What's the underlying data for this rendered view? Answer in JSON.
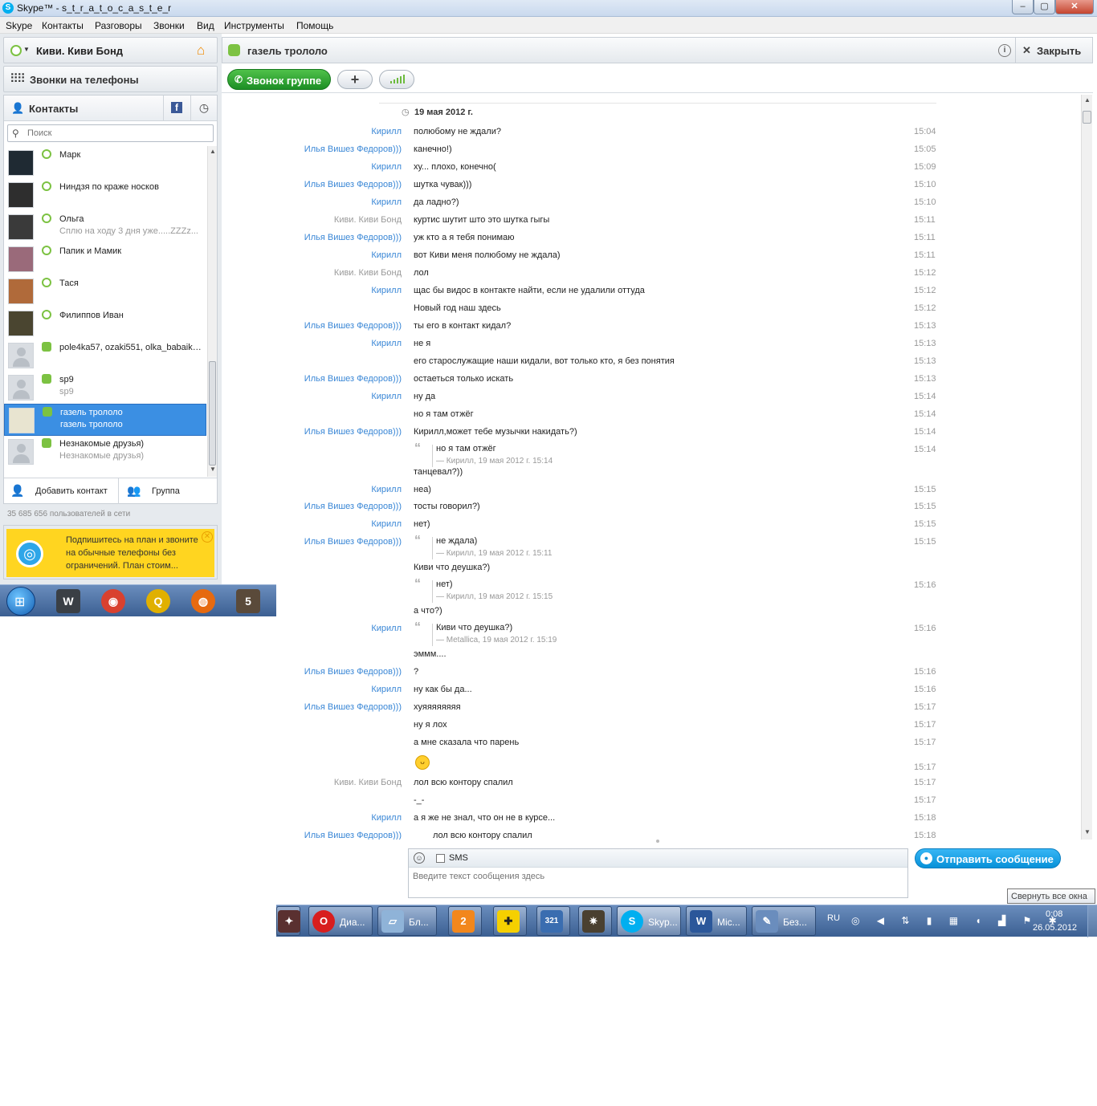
{
  "window": {
    "title": "Skype™ - s_t_r_a_t_o_c_a_s_t_e_r",
    "min_label": "–",
    "max_label": "▢",
    "close_label": "✕"
  },
  "menu": [
    "Skype",
    "Контакты",
    "Разговоры",
    "Звонки",
    "Вид",
    "Инструменты",
    "Помощь"
  ],
  "profile": {
    "name": "Киви. Киви Бонд",
    "home_icon": "⌂"
  },
  "phones": {
    "label": "Звонки на телефоны"
  },
  "contacts": {
    "tab_label": "Контакты",
    "fb_label": "f",
    "recent_icon": "◷",
    "search_placeholder": "Поиск",
    "items": [
      {
        "name": "Марк",
        "sub": ""
      },
      {
        "name": "Ниндзя по краже носков",
        "sub": ""
      },
      {
        "name": "Ольга",
        "sub": "Сплю на ходу 3 дня уже.....ZZZz..."
      },
      {
        "name": "Папик и Мамик",
        "sub": ""
      },
      {
        "name": "Тася",
        "sub": ""
      },
      {
        "name": "Филиппов Иван",
        "sub": ""
      },
      {
        "name": "pole4ka57, ozaki551, olka_babaika...",
        "sub": ""
      },
      {
        "name": "sp9",
        "sub": "sp9"
      },
      {
        "name": "газель трололо",
        "sub": "газель трололо"
      },
      {
        "name": "Незнакомые друзья)",
        "sub": "Незнакомые друзья)"
      }
    ],
    "add_contact": "Добавить контакт",
    "group": "Группа",
    "online": "35 685 656 пользователей в сети"
  },
  "promo": {
    "text": "Подпишитесь на план и звоните на обычные телефоны без ограничений. План стоим..."
  },
  "chat": {
    "title": "газель трололо",
    "info_label": "i",
    "close_label": "Закрыть",
    "call_group": "Звонок группе",
    "add_label": "+",
    "date": "19 мая 2012 г.",
    "messages": [
      {
        "who": "Кирилл",
        "text": "полюбому не ждали?",
        "time": "15:04"
      },
      {
        "who": "Илья Вишез Федоров)))",
        "text": "канечно!)",
        "time": "15:05"
      },
      {
        "who": "Кирилл",
        "text": "ху... плохо, конечно(",
        "time": "15:09"
      },
      {
        "who": "Илья Вишез Федоров)))",
        "text": "шутка чувак)))",
        "time": "15:10"
      },
      {
        "who": "Кирилл",
        "text": "да ладно?)",
        "time": "15:10"
      },
      {
        "who": "Киви. Киви Бонд",
        "text": "куртис шутит што это шутка гыгы",
        "time": "15:11"
      },
      {
        "who": "Илья Вишез Федоров)))",
        "text": "уж кто а я тебя понимаю",
        "time": "15:11"
      },
      {
        "who": "Кирилл",
        "text": "вот Киви меня полюбому не ждала)",
        "time": "15:11"
      },
      {
        "who": "Киви. Киви Бонд",
        "text": "лол",
        "time": "15:12"
      },
      {
        "who": "Кирилл",
        "text": "щас бы видос в контакте найти, если не удалили оттуда",
        "time": "15:12"
      },
      {
        "who": "",
        "text": "Новый год наш здесь",
        "time": "15:12"
      },
      {
        "who": "Илья Вишез Федоров)))",
        "text": "ты его в контакт кидал?",
        "time": "15:13"
      },
      {
        "who": "Кирилл",
        "text": "не я",
        "time": "15:13"
      },
      {
        "who": "",
        "text": "его старослужащие наши кидали, вот только кто, я без понятия",
        "time": "15:13"
      },
      {
        "who": "Илья Вишез Федоров)))",
        "text": "остаеться только искать",
        "time": "15:13"
      },
      {
        "who": "Кирилл",
        "text": "ну да",
        "time": "15:14"
      },
      {
        "who": "",
        "text": "но я там отжёг",
        "time": "15:14"
      },
      {
        "who": "Илья Вишез Федоров)))",
        "text": "Кирилл,может тебе музычки накидать?)",
        "time": "15:14"
      }
    ],
    "quote1": {
      "text": "но я там отжёг",
      "meta": "— Кирилл, 19 мая 2012 г. 15:14",
      "time": "15:14",
      "after": "танцевал?))"
    },
    "messages2": [
      {
        "who": "Кирилл",
        "text": "неа)",
        "time": "15:15"
      },
      {
        "who": "Илья Вишез Федоров)))",
        "text": "тосты говорил?)",
        "time": "15:15"
      },
      {
        "who": "Кирилл",
        "text": "нет)",
        "time": "15:15"
      }
    ],
    "quote2": {
      "who": "Илья Вишез Федоров)))",
      "text": "не ждала)",
      "meta": "— Кирилл, 19 мая 2012 г. 15:11",
      "time": "15:15",
      "after": "Киви что деушка?)"
    },
    "quote3": {
      "text": "нет)",
      "meta": "— Кирилл, 19 мая 2012 г. 15:15",
      "time": "15:16",
      "after": "а что?)"
    },
    "quote4": {
      "who": "Кирилл",
      "text": "Киви что деушка?)",
      "meta": "— Metallica, 19 мая 2012 г. 15:19",
      "time": "15:16",
      "after": "эммм...."
    },
    "messages3": [
      {
        "who": "Илья Вишез Федоров)))",
        "text": "?",
        "time": "15:16"
      },
      {
        "who": "Кирилл",
        "text": "ну как бы да...",
        "time": "15:16"
      },
      {
        "who": "Илья Вишез Федоров)))",
        "text": "хуяяяяяяяя",
        "time": "15:17"
      },
      {
        "who": "",
        "text": "ну я лох",
        "time": "15:17"
      },
      {
        "who": "",
        "text": "а мне сказала что парень",
        "time": "15:17"
      }
    ],
    "emoji_time": "15:17",
    "messages4": [
      {
        "who": "Киви. Киви Бонд",
        "text": "лол всю контору спалил",
        "time": "15:17"
      },
      {
        "who": "",
        "text": "-_-",
        "time": "15:17"
      },
      {
        "who": "Кирилл",
        "text": "а я же не знал, что он не в курсе...",
        "time": "15:18"
      },
      {
        "who": "Илья Вишез Федоров)))",
        "text": "лол всю контору спалил",
        "time": "15:18"
      }
    ],
    "sms_label": "SMS",
    "input_placeholder": "Введите текст сообщения здесь",
    "send_label": "Отправить сообщение"
  },
  "taskbar": {
    "tasks": [
      {
        "label": "Диа...",
        "icon": "O",
        "color": "#d81e1e"
      },
      {
        "label": "Бл...",
        "icon": "▱",
        "color": "#8fb3d8"
      },
      {
        "label": "",
        "icon": "2",
        "color": "#f2871c"
      },
      {
        "label": "",
        "icon": "✚",
        "color": "#f5d000"
      },
      {
        "label": "",
        "icon": "321",
        "color": "#3a6db0"
      },
      {
        "label": "",
        "icon": "✷",
        "color": "#4a4030"
      },
      {
        "label": "Skyp...",
        "icon": "S",
        "color": "#00aff0"
      },
      {
        "label": "Mic...",
        "icon": "W",
        "color": "#2b579a"
      },
      {
        "label": "Без...",
        "icon": "✎",
        "color": "#6a8dbd"
      }
    ],
    "lang": "RU",
    "tray": "◎ ◀ ⇅ ▮ ▦ ◖ ▟ ⚑ ✱",
    "time": "0:08",
    "date": "26.05.2012",
    "tooltip": "Свернуть все окна"
  }
}
